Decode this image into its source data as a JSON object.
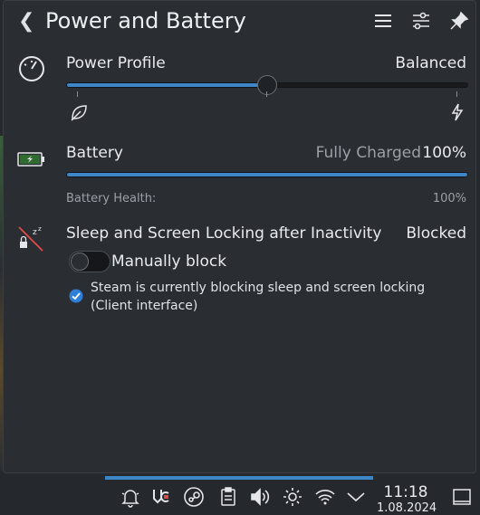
{
  "header": {
    "title": "Power and Battery"
  },
  "power_profile": {
    "label": "Power Profile",
    "value": "Balanced",
    "slider_fraction": 0.5
  },
  "battery": {
    "label": "Battery",
    "status": "Fully Charged",
    "percent": "100%",
    "charge_fraction": 1.0,
    "health_label": "Battery Health:",
    "health_value": "100%"
  },
  "sleep": {
    "label": "Sleep and Screen Locking after Inactivity",
    "status": "Blocked",
    "toggle_label": "Manually block",
    "toggle_on": false,
    "note": "Steam is currently blocking sleep and screen locking (Client interface)"
  },
  "clock": {
    "time": "11:18",
    "date": "1.08.2024"
  },
  "colors": {
    "accent": "#3d87c9",
    "background": "#2a2e33"
  }
}
